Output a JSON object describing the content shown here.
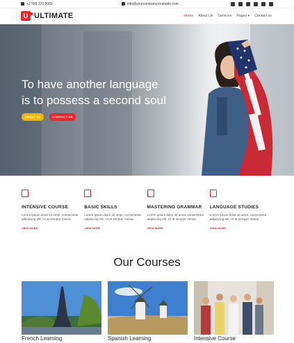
{
  "topbar": {
    "phone": "+1 555 123 8069",
    "email": "info@yourcompany.example.com",
    "social": [
      "facebook-icon",
      "twitter-icon",
      "linkedin-icon",
      "youtube-icon",
      "flickr-icon",
      "github-icon"
    ]
  },
  "nav": {
    "logo_letter": "U",
    "logo_text": "ULTIMATE",
    "items": [
      "Home",
      "About Us",
      "Services",
      "Pages ▾",
      "Contact us"
    ]
  },
  "hero": {
    "line1": "To have another language",
    "line2": "is to possess a second soul",
    "about_btn": "ABOUT US",
    "contact_btn": "CONTACT US"
  },
  "features": [
    {
      "title": "INTENSIVE COURSE",
      "text": "Lorem ipsum dolor sit amet, consectetur adipiscing elit. Ut at semper metus.",
      "more": "VIEW MORE",
      "icon": "book-icon"
    },
    {
      "title": "BASIC SKILLS",
      "text": "Lorem ipsum dolor sit amet, consectetur adipiscing elit. Ut at semper metus.",
      "more": "VIEW MORE",
      "icon": "pencil-icon"
    },
    {
      "title": "MASTERING GRAMMAR",
      "text": "Lorem ipsum dolor sit amet, consectetur adipiscing elit. Ut at semper metus.",
      "more": "VIEW MORE",
      "icon": "notes-icon"
    },
    {
      "title": "LANGUAGE STUDIES",
      "text": "Lorem ipsum dolor sit amet, consectetur adipiscing elit. Ut at semper metus.",
      "more": "VIEW MORE",
      "icon": "dictionary-icon"
    }
  ],
  "courses": {
    "title": "Our Courses",
    "cards": [
      {
        "caption": "French Learning"
      },
      {
        "caption": "Spanish Learning"
      },
      {
        "caption": "Intensive Course"
      }
    ]
  },
  "colors": {
    "accent": "#e8262b",
    "yellow": "#f4b400"
  }
}
